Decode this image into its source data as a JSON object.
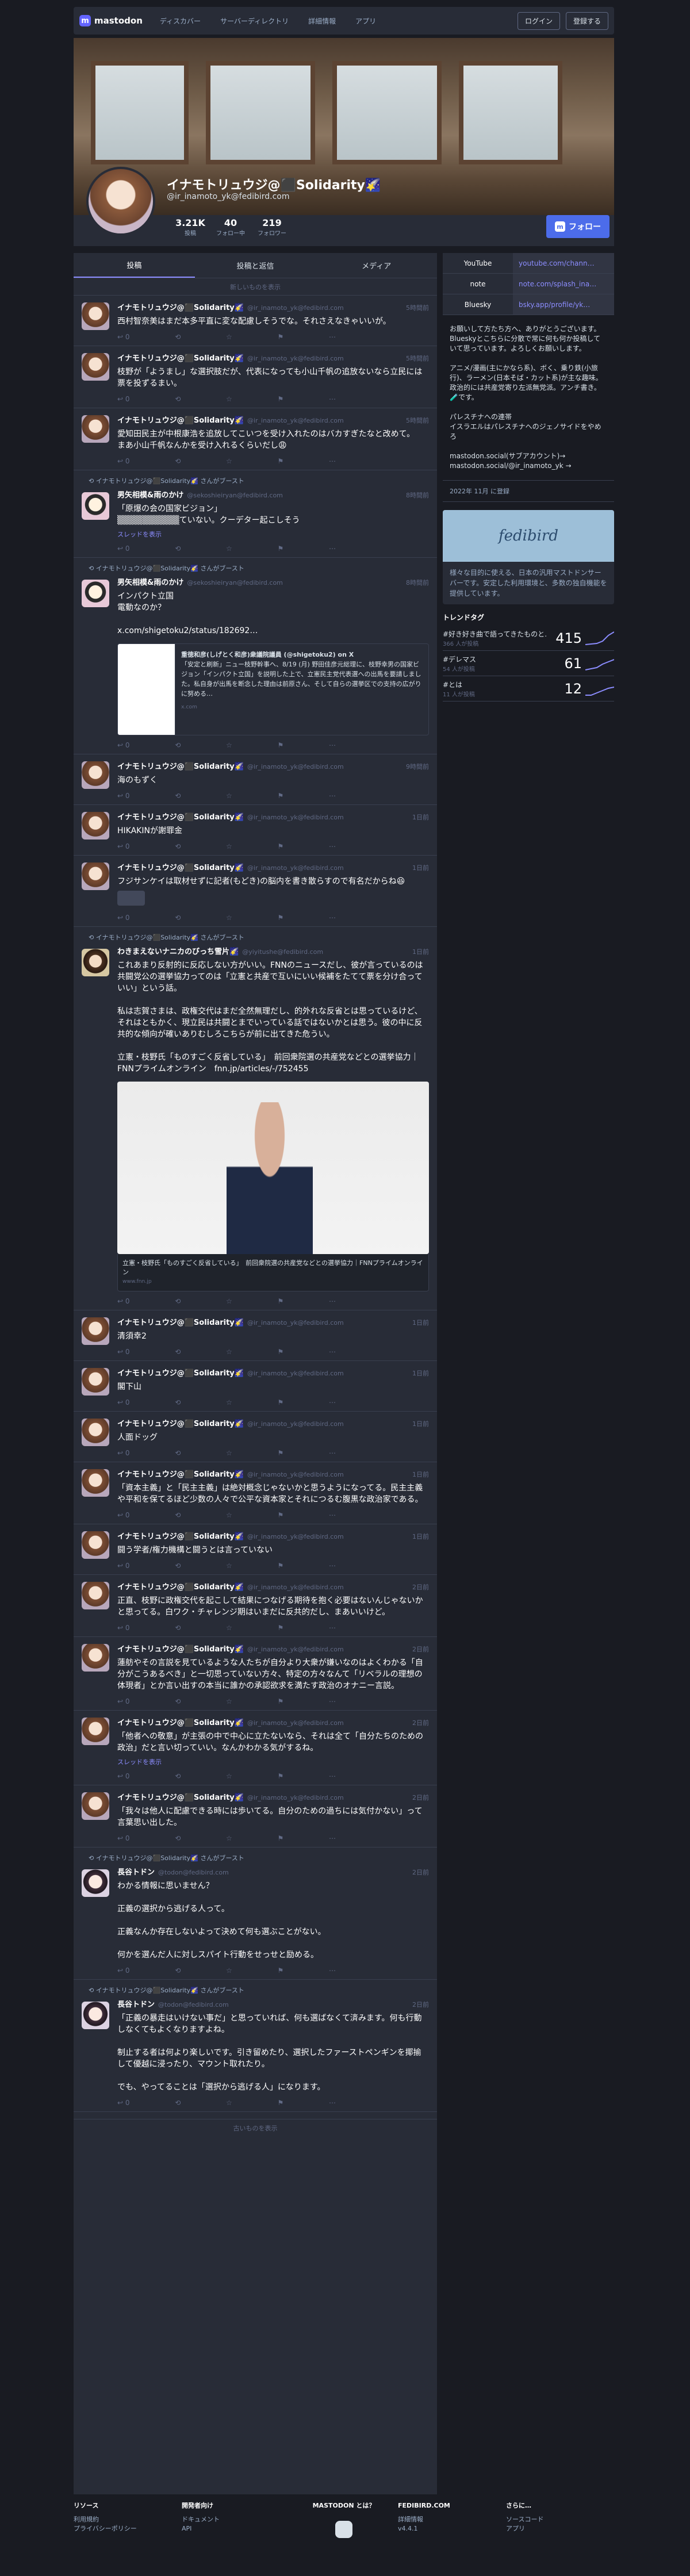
{
  "nav": {
    "logo": "mastodon",
    "links": [
      "ディスカバー",
      "サーバーディレクトリ",
      "詳細情報",
      "アプリ"
    ],
    "login": "ログイン",
    "signup": "登録する"
  },
  "profile": {
    "display_name": "イナモトリュウジ@⬛Solidarity🌠",
    "acct": "@ir_inamoto_yk@fedibird.com",
    "posts": "3.21K",
    "posts_label": "投稿",
    "following": "40",
    "following_label": "フォロー中",
    "followers": "219",
    "followers_label": "フォロワー",
    "follow_button": "フォロー"
  },
  "tabs": [
    "投稿",
    "投稿と返信",
    "メディア"
  ],
  "load_newer": "新しいものを表示",
  "load_older": "古いものを表示",
  "posts": [
    {
      "name": "イナモトリュウジ@⬛Solidarity🌠",
      "handle": "@ir_inamoto_yk@fedibird.com",
      "time": "5時間前",
      "body": "西村智奈美はまだ本多平直に変な配慮しそうでな。それさえなきゃいいが。",
      "acts": [
        "0",
        "",
        "",
        ""
      ]
    },
    {
      "name": "イナモトリュウジ@⬛Solidarity🌠",
      "handle": "@ir_inamoto_yk@fedibird.com",
      "time": "5時間前",
      "body": "枝野が「ようまし」な選択肢だが、代表になっても小山千帆の追放ないなら立民には票を投ずるまい。",
      "acts": [
        "0",
        "",
        "",
        ""
      ]
    },
    {
      "name": "イナモトリュウジ@⬛Solidarity🌠",
      "handle": "@ir_inamoto_yk@fedibird.com",
      "time": "5時間前",
      "body": "愛知田民主が中根康浩を追放してこいつを受け入れたのはバカすぎたなと改めて。\nまあ小山千帆なんかを受け入れるくらいだし😩",
      "acts": [
        "0",
        "",
        "",
        ""
      ]
    },
    {
      "boost": "イナモトリュウジ@⬛Solidarity🌠 さんがブースト",
      "name": "男矢相模&雨のかけ",
      "handle": "@sekoshieiryan@fedibird.com",
      "time": "8時間前",
      "body": "「原爆の会の国家ビジョン」\n▒▒▒▒▒▒▒▒▒▒ていない。クーデター起こしそう",
      "thread": "スレッドを表示",
      "acts": [
        "0",
        "",
        "",
        ""
      ],
      "av": "alt"
    },
    {
      "boost": "イナモトリュウジ@⬛Solidarity🌠 さんがブースト",
      "name": "男矢相模&雨のかけ",
      "handle": "@sekoshieiryan@fedibird.com",
      "time": "8時間前",
      "body": "インパクト立国\n電動なのか？\n\nx.com/shigetoku2/status/182692…",
      "card": {
        "title": "重徳和彦(しげとく和彦)衆議院議員 (@shigetoku2) on X",
        "text": "「安定と刷新」ニュー枝野幹事へ、8/19 (月) 野田佳彦元総理に、枝野幸男の国家ビジョン「インパクト立国」を説明した上で、立憲民主党代表選への出馬を要請しました。私自身が出馬を断念した理由は前原さん、そして自らの選挙区での支持の広がりに努める…",
        "src": "x.com"
      },
      "acts": [
        "0",
        "",
        "",
        ""
      ],
      "av": "alt"
    },
    {
      "name": "イナモトリュウジ@⬛Solidarity🌠",
      "handle": "@ir_inamoto_yk@fedibird.com",
      "time": "9時間前",
      "body": "海のもずく",
      "acts": [
        "0",
        "",
        "",
        ""
      ]
    },
    {
      "name": "イナモトリュウジ@⬛Solidarity🌠",
      "handle": "@ir_inamoto_yk@fedibird.com",
      "time": "1日前",
      "body": "HIKAKINが謝罪金",
      "acts": [
        "0",
        "",
        "",
        ""
      ]
    },
    {
      "name": "イナモトリュウジ@⬛Solidarity🌠",
      "handle": "@ir_inamoto_yk@fedibird.com",
      "time": "1日前",
      "body": "フジサンケイは取材せずに記者(もどき)の脳内を書き散らすので有名だからね😆",
      "emoji": true,
      "acts": [
        "0",
        "",
        "",
        ""
      ]
    },
    {
      "boost": "イナモトリュウジ@⬛Solidarity🌠 さんがブースト",
      "name": "わきまえないナニカのびっち雪片🌠",
      "handle": "@yiyitushe@fedibird.com",
      "time": "1日前",
      "body": "これあまり反射的に反応しない方がいい。FNNのニュースだし、彼が言っているのは共闘党公の選挙協力ってのは「立憲と共産で互いにいい候補をたてて票を分け合っていい」という話。\n\n私は志賀さまは、政権交代はまだ全然無理だし、的外れな反省とは思っているけど、それはともかく、現立民は共闘とまでいっている話ではないかとは思う。彼の中に反共的な傾向が確いありむしろこちらが前に出てきた危うい。\n\n立憲・枝野氏「ものすごく反省している」　前回衆院選の共産党などとの選挙協力｜FNNプライムオンライン　fnn.jp/articles/-/752455",
      "image": {
        "caption": "立憲・枝野氏「ものすごく反省している」　前回衆院選の共産党などとの選挙協力｜FNNプライムオンライン",
        "src": "www.fnn.jp"
      },
      "acts": [
        "0",
        "",
        "",
        ""
      ],
      "av": "alt2"
    },
    {
      "name": "イナモトリュウジ@⬛Solidarity🌠",
      "handle": "@ir_inamoto_yk@fedibird.com",
      "time": "1日前",
      "body": "清須幸2",
      "acts": [
        "0",
        "",
        "",
        ""
      ]
    },
    {
      "name": "イナモトリュウジ@⬛Solidarity🌠",
      "handle": "@ir_inamoto_yk@fedibird.com",
      "time": "1日前",
      "body": "閣下山",
      "acts": [
        "0",
        "",
        "",
        ""
      ]
    },
    {
      "name": "イナモトリュウジ@⬛Solidarity🌠",
      "handle": "@ir_inamoto_yk@fedibird.com",
      "time": "1日前",
      "body": "人面ドッグ",
      "acts": [
        "0",
        "",
        "",
        ""
      ]
    },
    {
      "name": "イナモトリュウジ@⬛Solidarity🌠",
      "handle": "@ir_inamoto_yk@fedibird.com",
      "time": "1日前",
      "body": "「資本主義」と「民主主義」は絶対概念じゃないかと思うようになってる。民主主義や平和を保てるほど少数の人々で公平な資本家とそれにつるむ腹黒な政治家である。",
      "acts": [
        "0",
        "",
        "",
        ""
      ]
    },
    {
      "name": "イナモトリュウジ@⬛Solidarity🌠",
      "handle": "@ir_inamoto_yk@fedibird.com",
      "time": "1日前",
      "body": "闘う学者/権力機構と闘うとは言っていない",
      "acts": [
        "0",
        "",
        "",
        ""
      ]
    },
    {
      "name": "イナモトリュウジ@⬛Solidarity🌠",
      "handle": "@ir_inamoto_yk@fedibird.com",
      "time": "2日前",
      "body": "正直、枝野に政権交代を起こして結果につなげる期待を抱く必要はないんじゃないかと思ってる。白ワク・チャレンジ期はいまだに反共的だし、まあいいけど。",
      "acts": [
        "0",
        "",
        "",
        ""
      ]
    },
    {
      "name": "イナモトリュウジ@⬛Solidarity🌠",
      "handle": "@ir_inamoto_yk@fedibird.com",
      "time": "2日前",
      "body": "蓮舫やその言説を見ているような人たちが自分より大衆が嫌いなのはよくわかる「自分がこうあるべき」と一切思っていない方々、特定の方々なんて「リベラルの理想の体現者」とか言い出すの本当に誰かの承認欲求を満たす政治のオナニー言説。",
      "acts": [
        "0",
        "",
        "",
        ""
      ]
    },
    {
      "name": "イナモトリュウジ@⬛Solidarity🌠",
      "handle": "@ir_inamoto_yk@fedibird.com",
      "time": "2日前",
      "body": "「他者への敬意」が主張の中で中心に立たないなら、それは全て「自分たちのための政治」だと言い切っていい。なんかわかる気がするね。",
      "thread": "スレッドを表示",
      "acts": [
        "0",
        "",
        "",
        ""
      ]
    },
    {
      "name": "イナモトリュウジ@⬛Solidarity🌠",
      "handle": "@ir_inamoto_yk@fedibird.com",
      "time": "2日前",
      "body": "「我々は他人に配慮できる時には歩いてる。自分のための過ちには気付かない」って言葉思い出した。",
      "acts": [
        "0",
        "",
        "",
        ""
      ]
    },
    {
      "boost": "イナモトリュウジ@⬛Solidarity🌠 さんがブースト",
      "name": "長谷トドン",
      "handle": "@todon@fedibird.com",
      "time": "2日前",
      "body": "わかる情報に思いません？\n\n正義の選択から逃げる人って。\n\n正義なんか存在しないよって決めて何も選ぶことがない。\n\n何かを選んだ人に対しスパイト行動をせっせと励める。",
      "acts": [
        "0",
        "",
        "",
        ""
      ],
      "av": "alt3"
    },
    {
      "boost": "イナモトリュウジ@⬛Solidarity🌠 さんがブースト",
      "name": "長谷トドン",
      "handle": "@todon@fedibird.com",
      "time": "2日前",
      "body": "「正義の暴走はいけない事だ」と思っていれば、何も選ばなくて済みます。何も行動しなくてもよくなりますよね。\n\n制止する者は何より楽しいです。引き留めたり、選択したファーストペンギンを揶揄して優越に浸ったり、マウント取れたり。\n\nでも、やってることは「選択から逃げる人」になります。",
      "acts": [
        "0",
        "",
        "",
        ""
      ],
      "av": "alt3"
    }
  ],
  "sidebar": {
    "fields": [
      {
        "k": "YouTube",
        "v": "youtube.com/chann…"
      },
      {
        "k": "note",
        "v": "note.com/splash_ina…"
      },
      {
        "k": "Bluesky",
        "v": "bsky.app/profile/yk…"
      }
    ],
    "bio": "お願いして方たち方へ、ありがとうございます。Blueskyとこちらに分散で常に何も何か投稿していて思っています。よろしくお願いします。\n\nアニメ/漫画(主にかなら系)、ボく、乗り鉄(小旅行)、ラーメン(日本そば・カット系)が主な趣味。政治的には共産党寄り左派無党派。アンチ書き。🧪です。\n\nパレスチナへの連帯\nイスラエルはパレスチナへのジェノサイドをやめろ\n\nmastodon.social(サブアカウント)→\nmastodon.social/@ir_inamoto_yk →",
    "joined": "2022年 11月 に登録",
    "server_name": "fedibird",
    "server_desc": "様々な目的に使える、日本の汎用マストドンサーバーです。安定した利用環境と、多数の独自機能を提供しています。",
    "trends_title": "トレンドタグ",
    "trends": [
      {
        "tag": "#好き好き曲で語ってきたものと…",
        "sub": "366 人が投稿",
        "count": "415"
      },
      {
        "tag": "#デレマス",
        "sub": "54 人が投稿",
        "count": "61"
      },
      {
        "tag": "#とは",
        "sub": "11 人が投稿",
        "count": "12"
      }
    ]
  },
  "footer": {
    "c1_title": "リソース",
    "c1": [
      "利用規約",
      "プライバシーポリシー"
    ],
    "c2_title": "開発者向け",
    "c2": [
      "ドキュメント",
      "API"
    ],
    "c3_title": "MASTODON とは？",
    "c4_title": "FEDIBIRD.COM",
    "c4": [
      "詳細情報",
      "v4.4.1"
    ],
    "c5_title": "さらに…",
    "c5": [
      "ソースコード",
      "アプリ"
    ]
  }
}
